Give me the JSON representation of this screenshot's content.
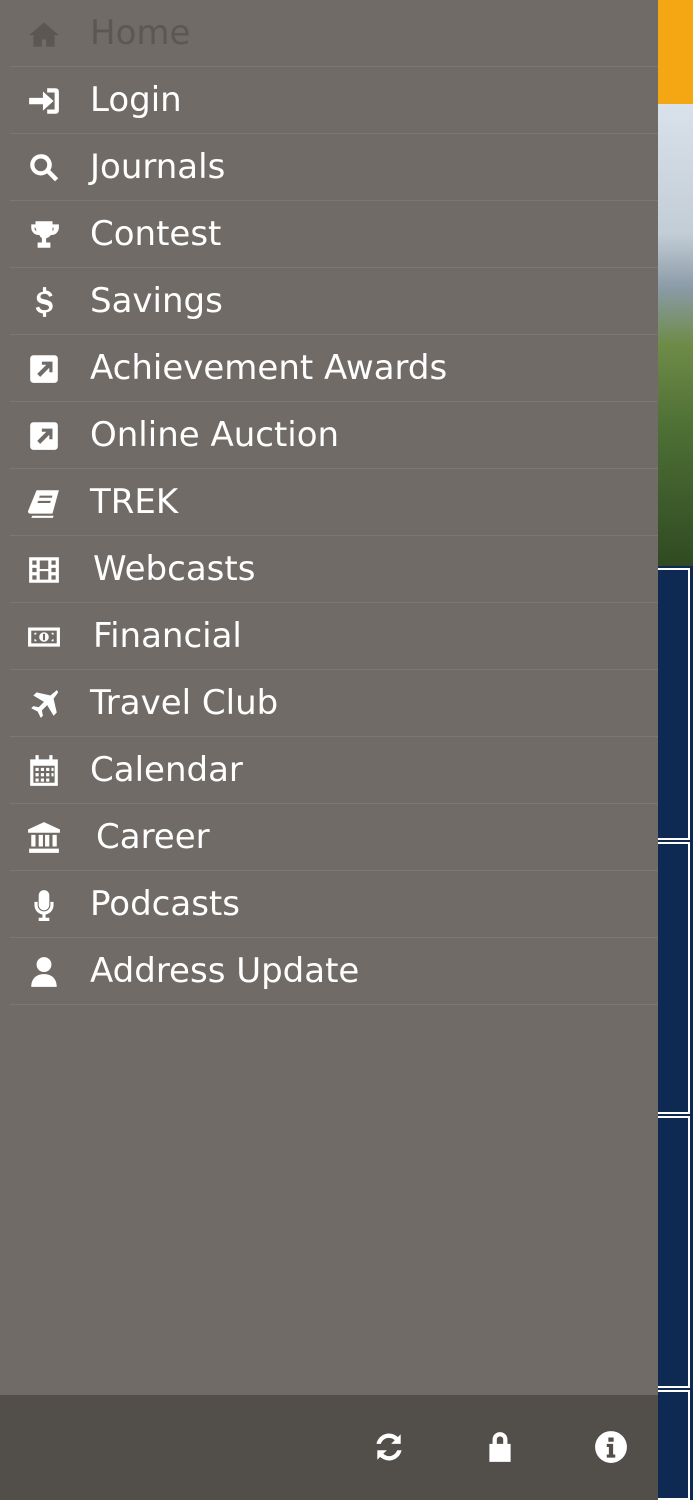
{
  "menu": {
    "items": [
      {
        "label": "Home",
        "icon": "home-icon",
        "active": true
      },
      {
        "label": "Login",
        "icon": "sign-in-icon"
      },
      {
        "label": "Journals",
        "icon": "search-icon"
      },
      {
        "label": "Contest",
        "icon": "trophy-icon"
      },
      {
        "label": "Savings",
        "icon": "dollar-icon"
      },
      {
        "label": "Achievement Awards",
        "icon": "external-link-square-icon"
      },
      {
        "label": "Online Auction",
        "icon": "external-link-square-icon"
      },
      {
        "label": "TREK",
        "icon": "book-icon"
      },
      {
        "label": "Webcasts",
        "icon": "film-icon"
      },
      {
        "label": "Financial",
        "icon": "money-icon"
      },
      {
        "label": "Travel Club",
        "icon": "plane-icon"
      },
      {
        "label": "Calendar",
        "icon": "calendar-icon"
      },
      {
        "label": "Career",
        "icon": "bank-icon"
      },
      {
        "label": "Podcasts",
        "icon": "microphone-icon"
      },
      {
        "label": "Address Update",
        "icon": "user-icon"
      }
    ]
  },
  "footer": {
    "buttons": [
      "refresh-icon",
      "lock-icon",
      "info-icon"
    ]
  },
  "colors": {
    "drawer_bg": "#706b66",
    "footer_bg": "#524e4a",
    "accent": "#f4a712",
    "app_bg": "#0f2a52"
  }
}
